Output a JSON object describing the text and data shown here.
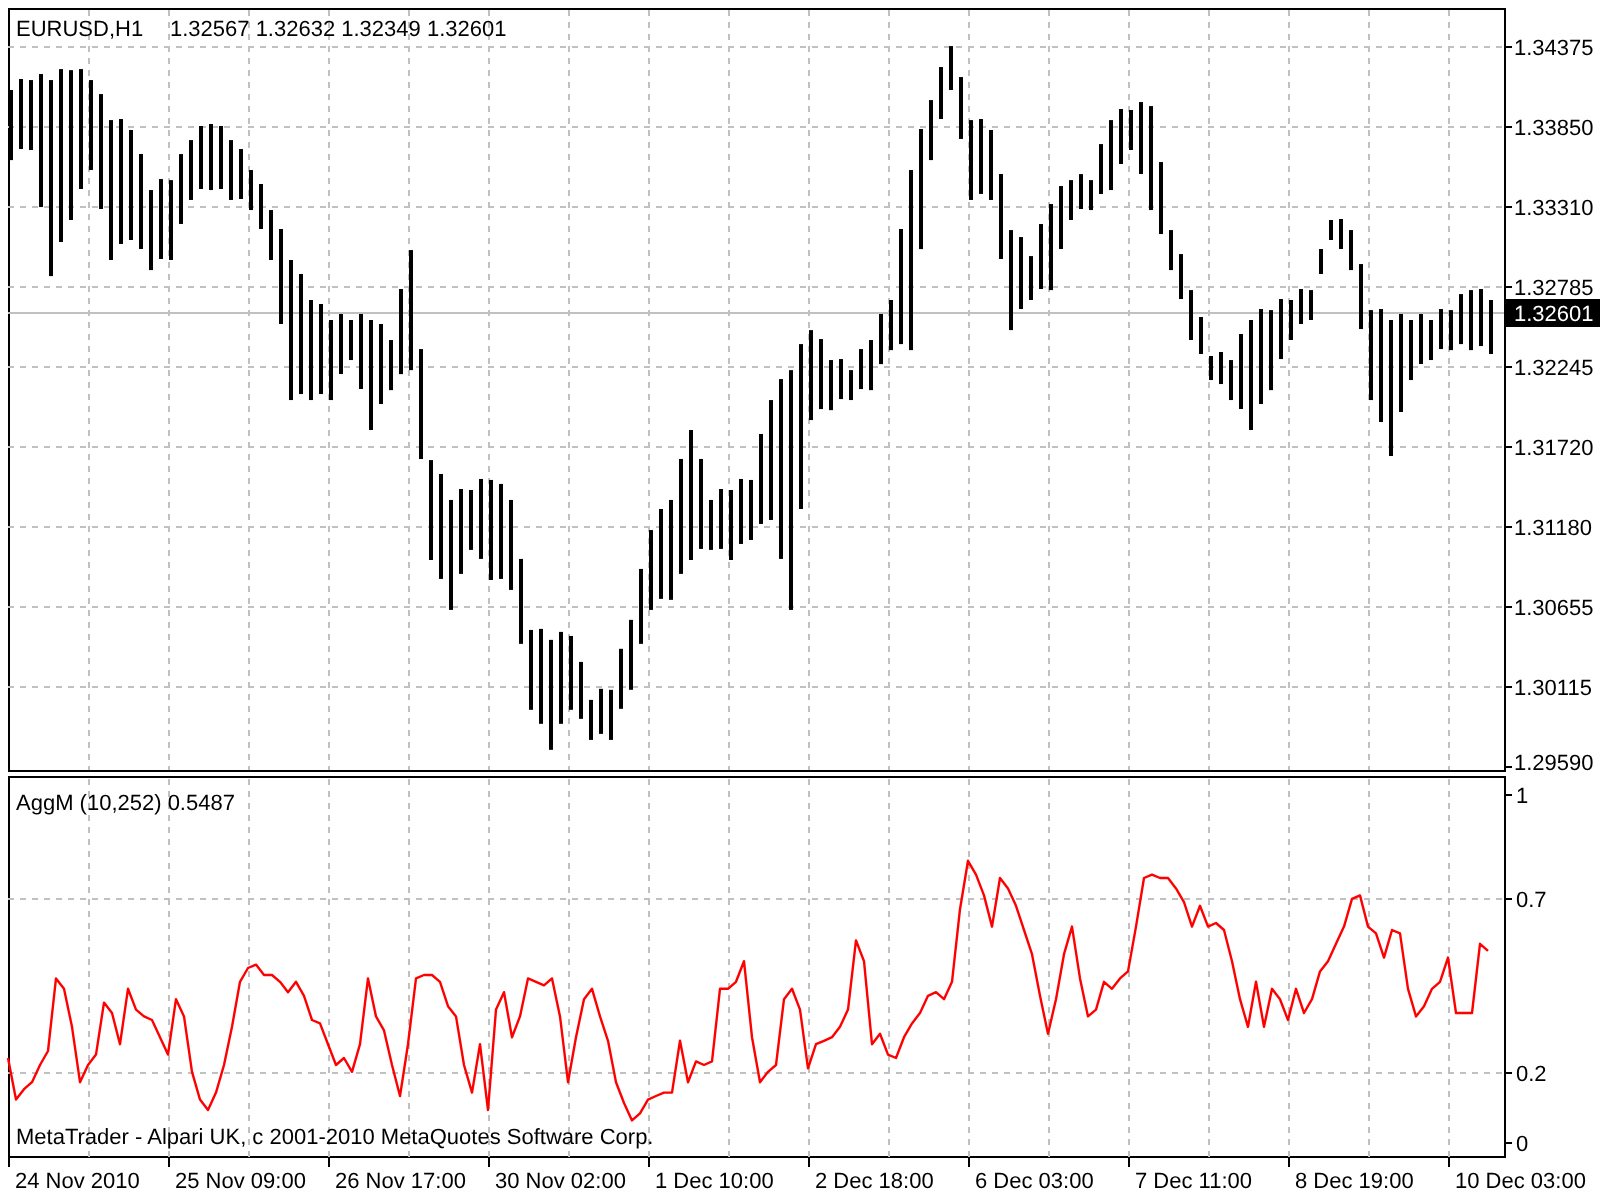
{
  "price_chart": {
    "symbol": "EURUSD,H1",
    "quote": "1.32567 1.32632 1.32349 1.32601",
    "last_price": "1.32601",
    "price_labels": [
      "1.34375",
      "1.33850",
      "1.33310",
      "1.32785",
      "1.32245",
      "1.31720",
      "1.31180",
      "1.30655",
      "1.30115",
      "1.29590"
    ]
  },
  "indicator": {
    "legend": "AggM (10,252) 0.5487",
    "chart_data": {
      "type": "line",
      "series": [
        {
          "color": "#ff0000",
          "values": [
            0.24,
            0.12,
            0.15,
            0.17,
            0.22,
            0.26,
            0.47,
            0.44,
            0.33,
            0.17,
            0.22,
            0.25,
            0.4,
            0.37,
            0.28,
            0.44,
            0.38,
            0.36,
            0.35,
            0.3,
            0.25,
            0.41,
            0.36,
            0.2,
            0.12,
            0.09,
            0.14,
            0.22,
            0.33,
            0.46,
            0.5,
            0.51,
            0.48,
            0.48,
            0.46,
            0.43,
            0.46,
            0.42,
            0.35,
            0.34,
            0.28,
            0.22,
            0.24,
            0.2,
            0.28,
            0.47,
            0.36,
            0.32,
            0.22,
            0.13,
            0.28,
            0.47,
            0.48,
            0.48,
            0.46,
            0.39,
            0.36,
            0.22,
            0.14,
            0.28,
            0.09,
            0.38,
            0.43,
            0.3,
            0.36,
            0.47,
            0.46,
            0.45,
            0.47,
            0.36,
            0.17,
            0.3,
            0.41,
            0.44,
            0.36,
            0.29,
            0.17,
            0.11,
            0.06,
            0.08,
            0.12,
            0.13,
            0.14,
            0.14,
            0.29,
            0.17,
            0.23,
            0.22,
            0.23,
            0.44,
            0.44,
            0.46,
            0.52,
            0.3,
            0.17,
            0.2,
            0.22,
            0.41,
            0.44,
            0.38,
            0.21,
            0.28,
            0.29,
            0.3,
            0.33,
            0.38,
            0.58,
            0.52,
            0.28,
            0.31,
            0.25,
            0.24,
            0.3,
            0.34,
            0.37,
            0.42,
            0.43,
            0.41,
            0.46,
            0.67,
            0.81,
            0.77,
            0.71,
            0.62,
            0.76,
            0.73,
            0.68,
            0.61,
            0.54,
            0.42,
            0.31,
            0.41,
            0.54,
            0.62,
            0.47,
            0.36,
            0.38,
            0.46,
            0.44,
            0.47,
            0.49,
            0.62,
            0.76,
            0.77,
            0.76,
            0.76,
            0.73,
            0.69,
            0.62,
            0.68,
            0.62,
            0.63,
            0.61,
            0.52,
            0.41,
            0.33,
            0.46,
            0.33,
            0.44,
            0.41,
            0.35,
            0.44,
            0.37,
            0.41,
            0.49,
            0.52,
            0.57,
            0.62,
            0.7,
            0.71,
            0.62,
            0.6,
            0.53,
            0.61,
            0.6,
            0.44,
            0.36,
            0.39,
            0.44,
            0.46,
            0.53,
            0.37,
            0.37,
            0.37,
            0.57,
            0.55
          ]
        }
      ],
      "ylim": [
        -0.046,
        1.052
      ],
      "yticks": [
        {
          "value": 1,
          "label": "1"
        },
        {
          "value": 0.7,
          "label": "0.7"
        },
        {
          "value": 0.2,
          "label": "0.2"
        },
        {
          "value": 0,
          "label": "0"
        }
      ]
    }
  },
  "time_axis": [
    "24 Nov 2010",
    "25 Nov 09:00",
    "26 Nov 17:00",
    "30 Nov 02:00",
    "1 Dec 10:00",
    "2 Dec 18:00",
    "6 Dec 03:00",
    "7 Dec 11:00",
    "8 Dec 19:00",
    "10 Dec 03:00"
  ],
  "copyright": "MetaTrader - Alpari UK, c 2001-2010 MetaQuotes Software Corp."
}
